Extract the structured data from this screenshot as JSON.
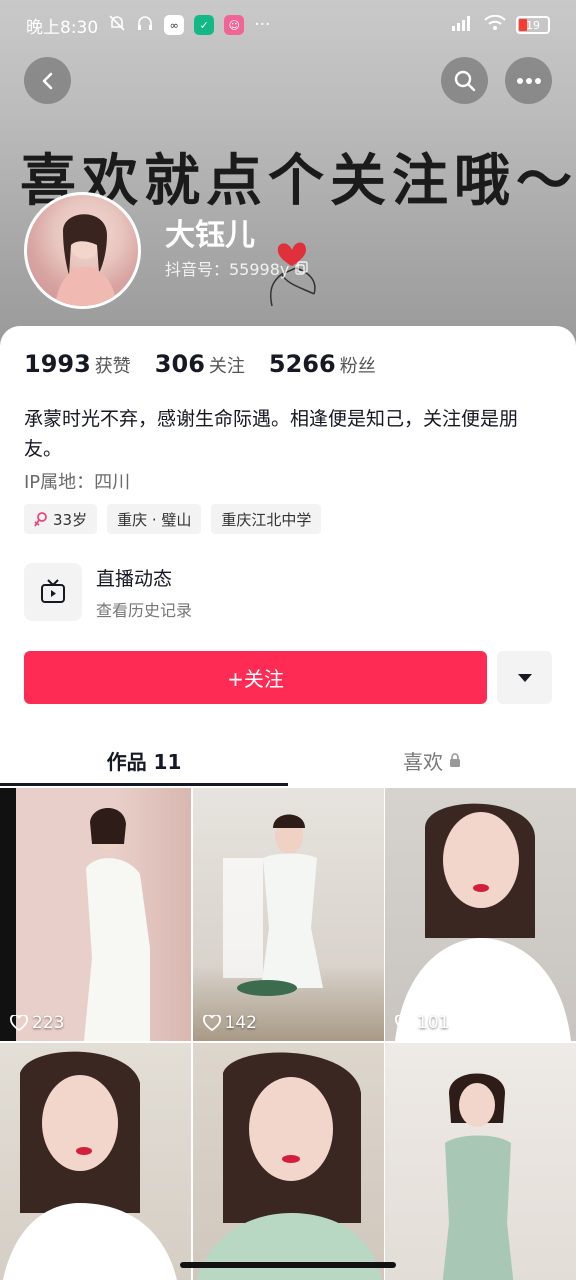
{
  "status_bar": {
    "time": "晚上8:30",
    "battery": "19"
  },
  "banner": {
    "text": "喜欢就点个关注哦～"
  },
  "profile": {
    "name": "大钰儿",
    "douyin_id": "抖音号：55998y"
  },
  "stats": [
    {
      "num": "1993",
      "label": "获赞"
    },
    {
      "num": "306",
      "label": "关注"
    },
    {
      "num": "5266",
      "label": "粉丝"
    }
  ],
  "bio": "承蒙时光不弃，感谢生命际遇。相逢便是知己，关注便是朋友。",
  "ip_location": "IP属地：四川",
  "tags": [
    {
      "label": "33岁",
      "icon": "female-icon"
    },
    {
      "label": "重庆 · 璧山"
    },
    {
      "label": "重庆江北中学"
    }
  ],
  "live": {
    "title": "直播动态",
    "subtitle": "查看历史记录"
  },
  "follow_button": "+关注",
  "tabs": [
    {
      "label": "作品 11",
      "active": true
    },
    {
      "label": "喜欢",
      "locked": true
    }
  ],
  "videos": [
    {
      "likes": "223"
    },
    {
      "likes": "142"
    },
    {
      "likes": "101"
    },
    {
      "likes": ""
    },
    {
      "likes": ""
    },
    {
      "likes": ""
    }
  ],
  "colors": {
    "accent": "#fe2c55",
    "text": "#161823"
  }
}
